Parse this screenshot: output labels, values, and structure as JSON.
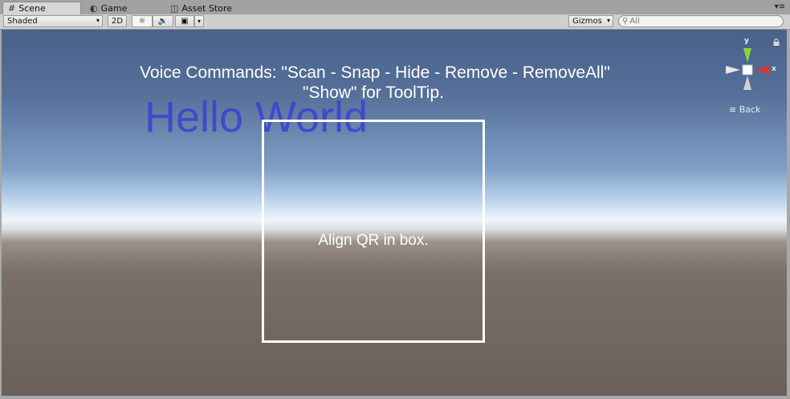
{
  "tabs": [
    {
      "label": "Scene",
      "icon": "grid-icon",
      "active": true
    },
    {
      "label": "Game",
      "icon": "pacman-icon",
      "active": false
    },
    {
      "label": "Asset Store",
      "icon": "store-icon",
      "active": false
    }
  ],
  "toolbar": {
    "shading_mode": "Shaded",
    "mode_2d": "2D",
    "gizmos": "Gizmos",
    "search_placeholder": "All"
  },
  "scene": {
    "commands_line1": "Voice Commands: \"Scan - Snap - Hide - Remove - RemoveAll\"",
    "commands_line2": "\"Show\" for ToolTip.",
    "hello_text": "Hello World",
    "qr_instruction": "Align QR in box."
  },
  "gizmo": {
    "y_label": "y",
    "x_label": "x",
    "back_label": "Back"
  },
  "colors": {
    "x_axis": "#d93a28",
    "y_axis": "#8cd43a",
    "hello_text": "#3e3fd1"
  }
}
